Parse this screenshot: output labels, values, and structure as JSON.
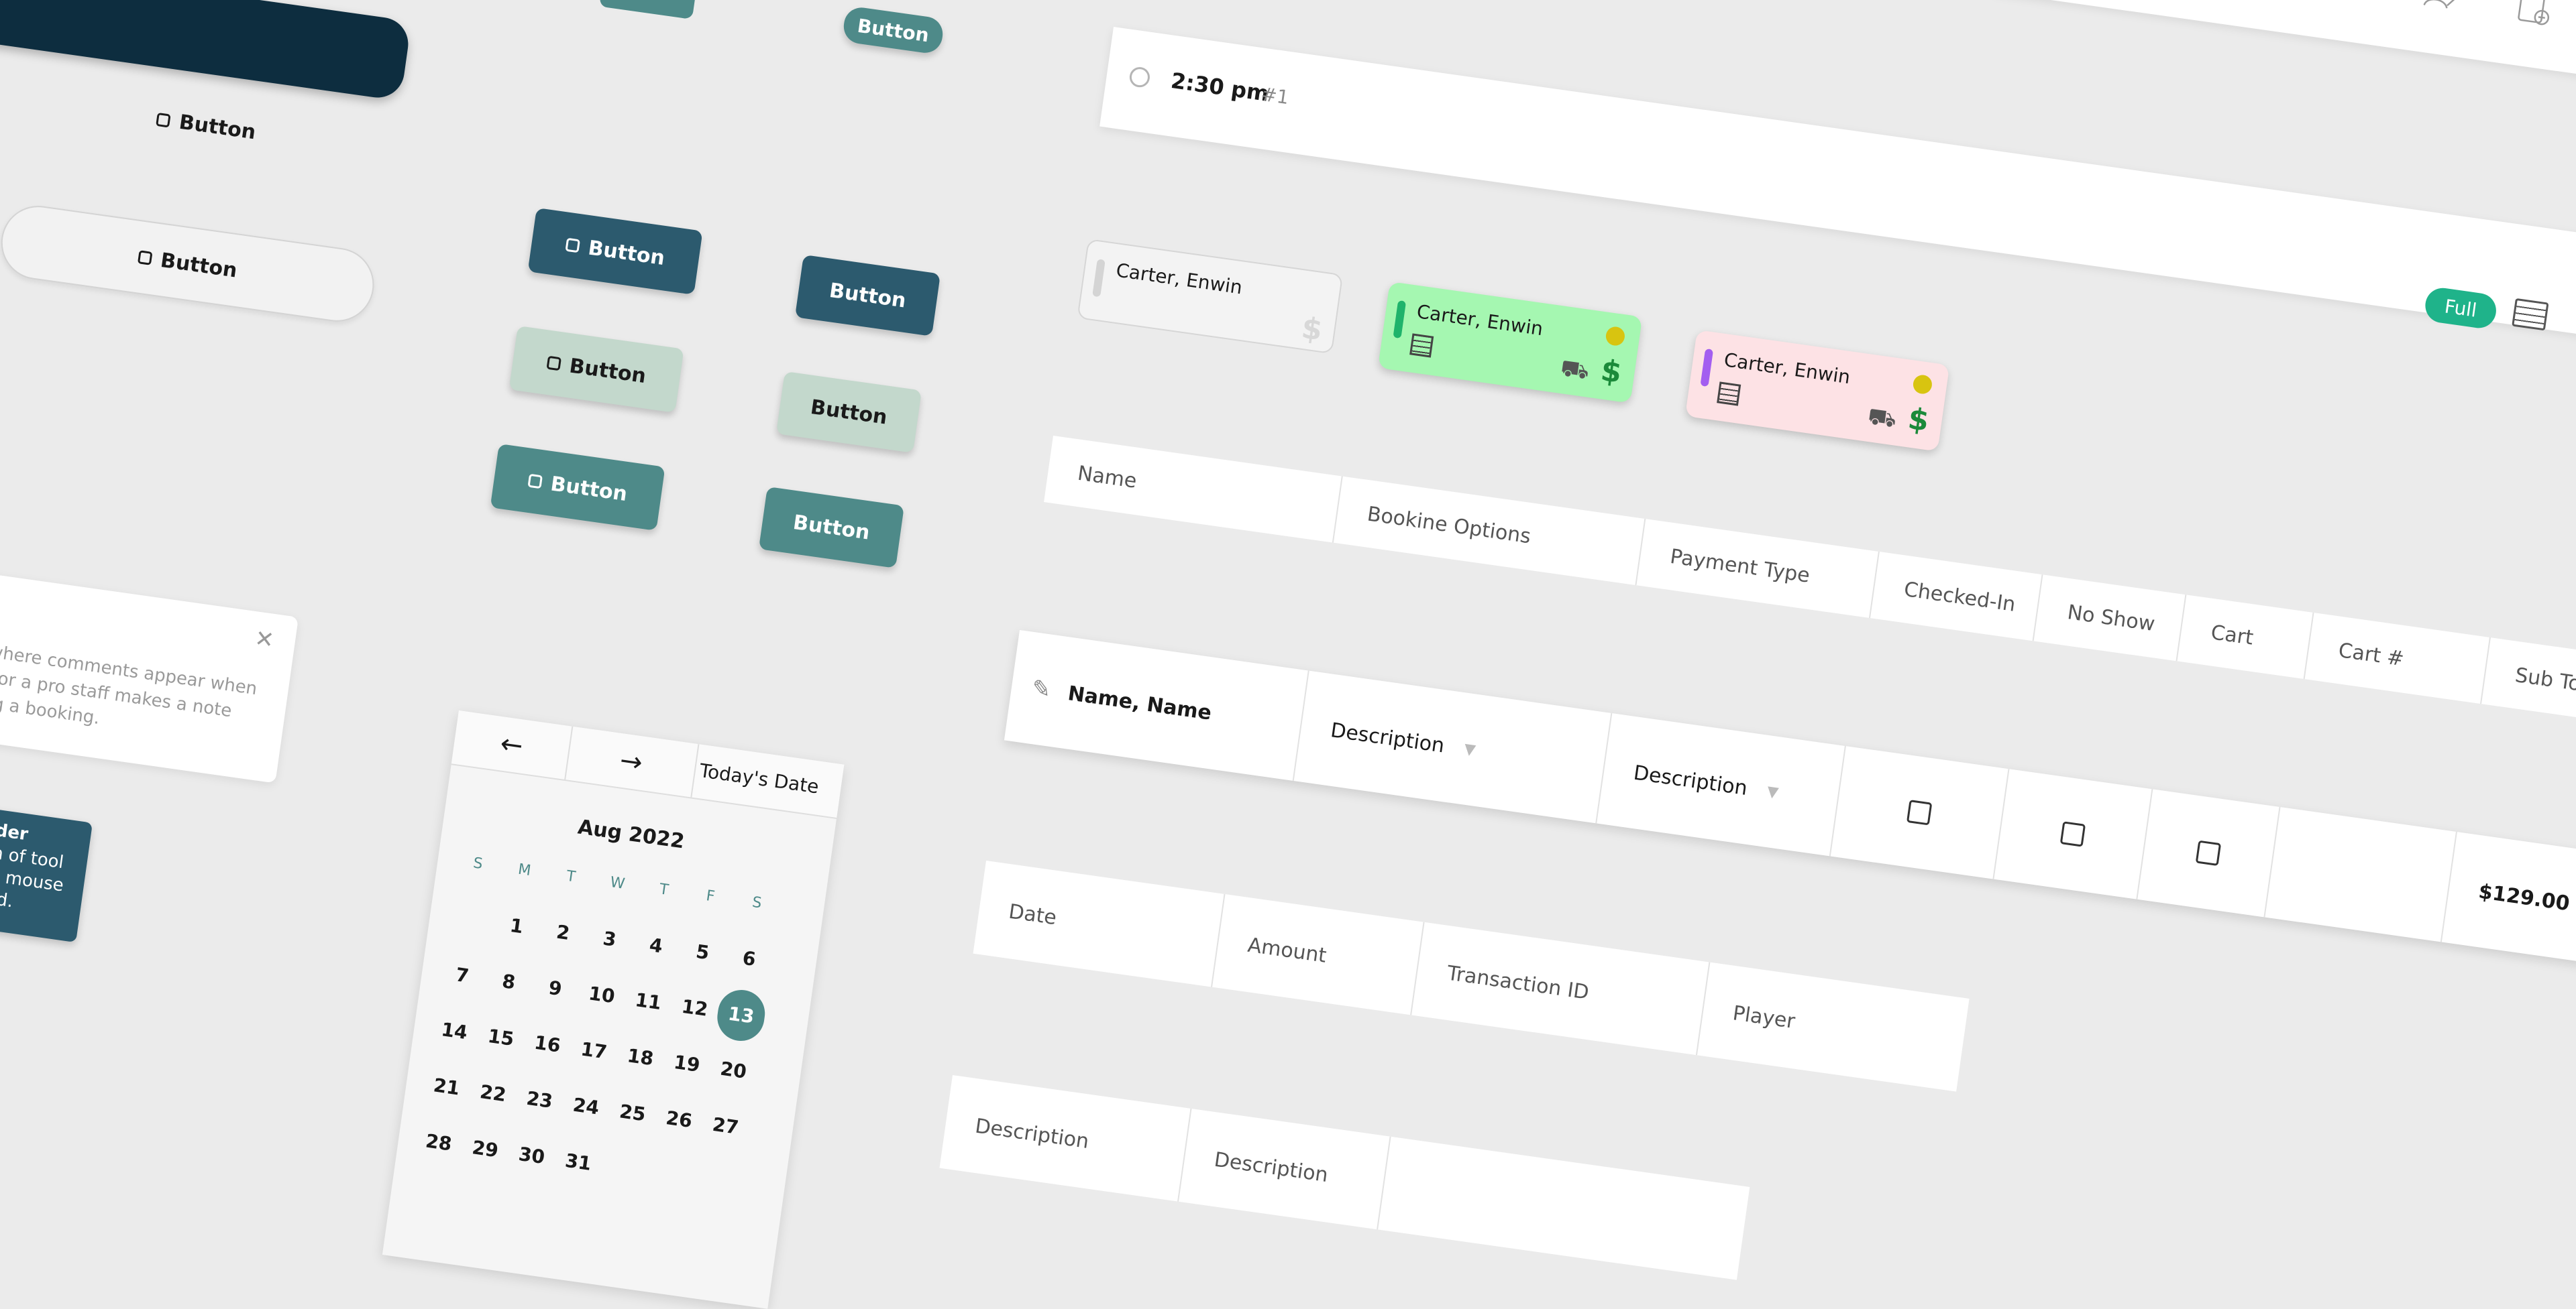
{
  "colors": {
    "dark": "#2c5a6e",
    "light": "#c3d8cc",
    "teal": "#4e8a89",
    "green_card": "#a5f7b1",
    "pink_card": "#fde2e5",
    "full_badge": "#1fb38a"
  },
  "buttons": {
    "label": "Button"
  },
  "header": {
    "time": "2:30 pm",
    "number": "#1",
    "badge": "Full"
  },
  "tee_cards": [
    {
      "name": "Carter, Enwin",
      "state": "empty"
    },
    {
      "name": "Carter, Enwin",
      "state": "green"
    },
    {
      "name": "Carter, Enwin",
      "state": "pink"
    }
  ],
  "booking_table": {
    "headers": [
      "Name",
      "Bookine Options",
      "Payment Type",
      "Checked-In",
      "No Show",
      "Cart",
      "Cart #",
      "Sub Tot"
    ],
    "row": {
      "name": "Name, Name",
      "option": "Description",
      "payment": "Description",
      "subtotal": "$129.00"
    }
  },
  "transaction_table": {
    "headers": [
      "Date",
      "Amount",
      "Transaction ID",
      "Player"
    ]
  },
  "description_table": {
    "headers": [
      "Description",
      "Description"
    ]
  },
  "comment": {
    "lines": [
      "where comments appear when",
      "r or a pro staff makes a note",
      "ng a booking."
    ]
  },
  "tooltip": {
    "lines": [
      "der",
      "n of tool",
      "n mouse",
      "ed."
    ]
  },
  "calendar": {
    "today_label": "Today's Date",
    "month": "Aug 2022",
    "weekdays": [
      "S",
      "M",
      "T",
      "W",
      "T",
      "F",
      "S"
    ],
    "weeks": [
      [
        "",
        "1",
        "2",
        "3",
        "4",
        "5",
        "6"
      ],
      [
        "7",
        "8",
        "9",
        "10",
        "11",
        "12",
        "13"
      ],
      [
        "14",
        "15",
        "16",
        "17",
        "18",
        "19",
        "20"
      ],
      [
        "21",
        "22",
        "23",
        "24",
        "25",
        "26",
        "27"
      ],
      [
        "28",
        "29",
        "30",
        "31",
        "",
        "",
        ""
      ]
    ],
    "selected": "13"
  },
  "icons": [
    "calendar-add-icon",
    "checklist-icon",
    "compass-icon",
    "mail-icon",
    "user-edit-icon",
    "clipboard-add-icon"
  ]
}
